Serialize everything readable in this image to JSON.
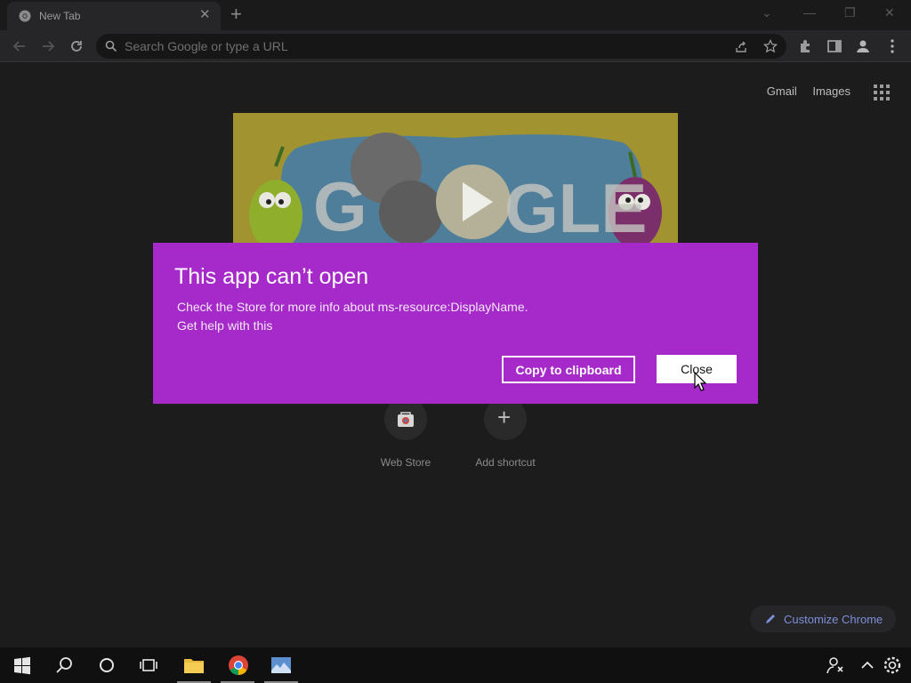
{
  "tab": {
    "title": "New Tab",
    "close_icon": "close-icon",
    "new_tab_icon": "plus-icon"
  },
  "toolbar": {
    "omnibox_placeholder": "Search Google or type a URL"
  },
  "ntp": {
    "links": [
      "Gmail",
      "Images"
    ],
    "shortcuts": [
      {
        "label": "Web Store",
        "icon": "web-store-icon"
      },
      {
        "label": "Add shortcut",
        "icon": "plus-icon"
      }
    ],
    "customize_label": "Customize Chrome"
  },
  "dialog": {
    "title": "This app can’t open",
    "message": "Check the Store for more info about ms-resource:DisplayName.",
    "help_link": "Get help with this",
    "copy_label": "Copy to clipboard",
    "close_label": "Close",
    "accent": "#a629c9"
  },
  "taskbar": {
    "icons": [
      "windows-start-icon",
      "search-icon",
      "cortana-icon",
      "task-view-icon",
      "file-explorer-icon",
      "chrome-icon",
      "photos-app-icon",
      "people-icon",
      "chevron-up-icon",
      "settings-icon"
    ]
  }
}
